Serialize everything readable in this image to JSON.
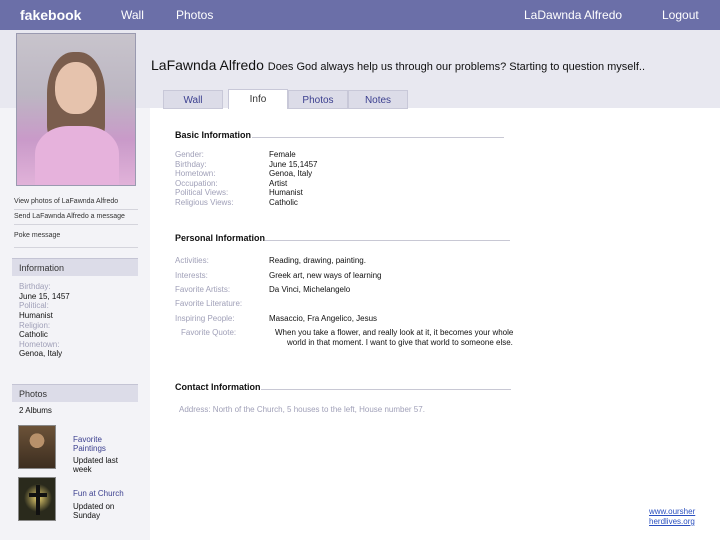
{
  "topbar": {
    "brand": "fakebook",
    "nav_wall": "Wall",
    "nav_photos": "Photos",
    "user_name": "LaDawnda Alfredo",
    "logout": "Logout"
  },
  "profile": {
    "name": "LaFawnda Alfredo",
    "status": "Does God always help us through our problems? Starting to question myself.."
  },
  "tabs": [
    "Wall",
    "Info",
    "Photos",
    "Notes"
  ],
  "active_tab": "Info",
  "sidebar": {
    "links": [
      "View photos of LaFawnda Alfredo",
      "Send LaFawnda Alfredo a message",
      "Poke message"
    ],
    "info_header": "Information",
    "info": {
      "birthday_label": "Birthday:",
      "birthday": "June 15, 1457",
      "political_label": "Political:",
      "political": "Humanist",
      "religion_label": "Religion:",
      "religion": "Catholic",
      "hometown_label": "Hometown:",
      "hometown": "Genoa, Italy"
    },
    "photos_header": "Photos",
    "albums_count": "2 Albums",
    "albums": [
      {
        "title": "Favorite Paintings",
        "updated": "Updated last week"
      },
      {
        "title": "Fun at Church",
        "updated": "Updated on Sunday"
      }
    ]
  },
  "basic": {
    "title": "Basic Information",
    "rows": [
      {
        "label": "Gender:",
        "value": "Female"
      },
      {
        "label": "Birthday:",
        "value": "June 15,1457"
      },
      {
        "label": "Hometown:",
        "value": "Genoa, Italy"
      },
      {
        "label": "Occupation:",
        "value": "Artist"
      },
      {
        "label": "Political Views:",
        "value": "Humanist"
      },
      {
        "label": "Religious Views:",
        "value": "Catholic"
      }
    ]
  },
  "personal": {
    "title": "Personal Information",
    "rows": [
      {
        "label": "Activities:",
        "value": "Reading, drawing, painting."
      },
      {
        "label": "Interests:",
        "value": "Greek art, new ways of learning"
      },
      {
        "label": "Favorite Artists:",
        "value": "Da Vinci, Michelangelo"
      },
      {
        "label": "Favorite Literature:",
        "value": ""
      },
      {
        "label": "Inspiring People:",
        "value": "Masaccio, Fra Angelico, Jesus"
      }
    ],
    "quote_label": "Favorite Quote:",
    "quote_line1": "When you take a flower, and really look at it, it becomes your whole",
    "quote_line2": "world in that moment. I want to give that world to someone else."
  },
  "contact": {
    "title": "Contact Information",
    "address": "Address: North of the Church, 5 houses to the left, House number 57."
  },
  "footer": {
    "link_line1": "www.oursher",
    "link_line2": "herdlives.org"
  }
}
